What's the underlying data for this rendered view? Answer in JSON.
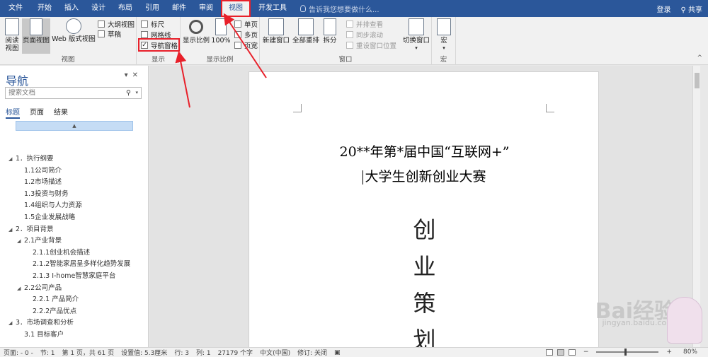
{
  "menubar": {
    "tabs": [
      "文件",
      "开始",
      "插入",
      "设计",
      "布局",
      "引用",
      "邮件",
      "审阅",
      "视图",
      "开发工具"
    ],
    "active_tab": "视图",
    "tell_me": "告诉我您想要做什么...",
    "login": "登录",
    "share": "共享"
  },
  "ribbon": {
    "view_group": {
      "read_mode": "阅读\n视图",
      "print_layout": "页面视图",
      "web_layout": "Web 版式视图",
      "outline": "大纲视图",
      "draft": "草稿",
      "label": "视图"
    },
    "show_group": {
      "ruler": "标尺",
      "gridlines": "网格线",
      "nav_pane": "导航窗格",
      "nav_pane_checked": "✓",
      "label": "显示"
    },
    "zoom_group": {
      "zoom": "显示比例",
      "hundred": "100%",
      "one_page": "单页",
      "multi_page": "多页",
      "page_width": "页宽",
      "label": "显示比例"
    },
    "window_group": {
      "new_window": "新建窗口",
      "arrange_all": "全部重排",
      "split": "拆分",
      "side_by_side": "并排查看",
      "sync_scroll": "同步滚动",
      "reset_pos": "重设窗口位置",
      "switch": "切换窗口",
      "label": "窗口"
    },
    "macro_group": {
      "macro": "宏",
      "label": "宏"
    }
  },
  "nav": {
    "title": "导航",
    "search_placeholder": "搜索文档",
    "tabs": [
      "标题",
      "页面",
      "结果"
    ],
    "outline": [
      {
        "text": "1．执行纲要",
        "level": 0
      },
      {
        "text": "1.1公司简介",
        "level": 1
      },
      {
        "text": "1.2市场描述",
        "level": 1
      },
      {
        "text": "1.3投资与财务",
        "level": 1
      },
      {
        "text": "1.4组织与人力资源",
        "level": 1
      },
      {
        "text": "1.5企业发展战略",
        "level": 1
      },
      {
        "text": "2．项目背景",
        "level": 0
      },
      {
        "text": "2.1产业背景",
        "level": 1,
        "expand": true
      },
      {
        "text": "2.1.1创业机会描述",
        "level": 2
      },
      {
        "text": "2.1.2智能家居呈多样化趋势发展",
        "level": 2
      },
      {
        "text": "2.1.3 I-home智慧家庭平台",
        "level": 2
      },
      {
        "text": "2.2公司产品",
        "level": 1,
        "expand": true
      },
      {
        "text": "2.2.1 产品简介",
        "level": 2
      },
      {
        "text": "2.2.2产品优点",
        "level": 2
      },
      {
        "text": "3．市场调查和分析",
        "level": 0
      },
      {
        "text": "3.1 目标客户",
        "level": 1
      }
    ]
  },
  "document": {
    "line1": "20**年第*届中国“互联网+”",
    "line2": "大学生创新创业大赛",
    "big_chars": [
      "创",
      "业",
      "策",
      "划"
    ]
  },
  "status": {
    "page": "页面: - 0 -",
    "section": "节: 1",
    "page_count": "第 1 页，共 61 页",
    "position": "设置值: 5.3厘米",
    "row": "行: 3",
    "col": "列: 1",
    "words": "27179 个字",
    "lang": "中文(中国)",
    "track": "修订: 关闭",
    "zoom": "80%"
  },
  "watermark": {
    "brand": "Bai经验",
    "url": "jingyan.baidu.com"
  },
  "colors": {
    "ribbon_blue": "#2b579a",
    "highlight_red": "#e8202a"
  }
}
